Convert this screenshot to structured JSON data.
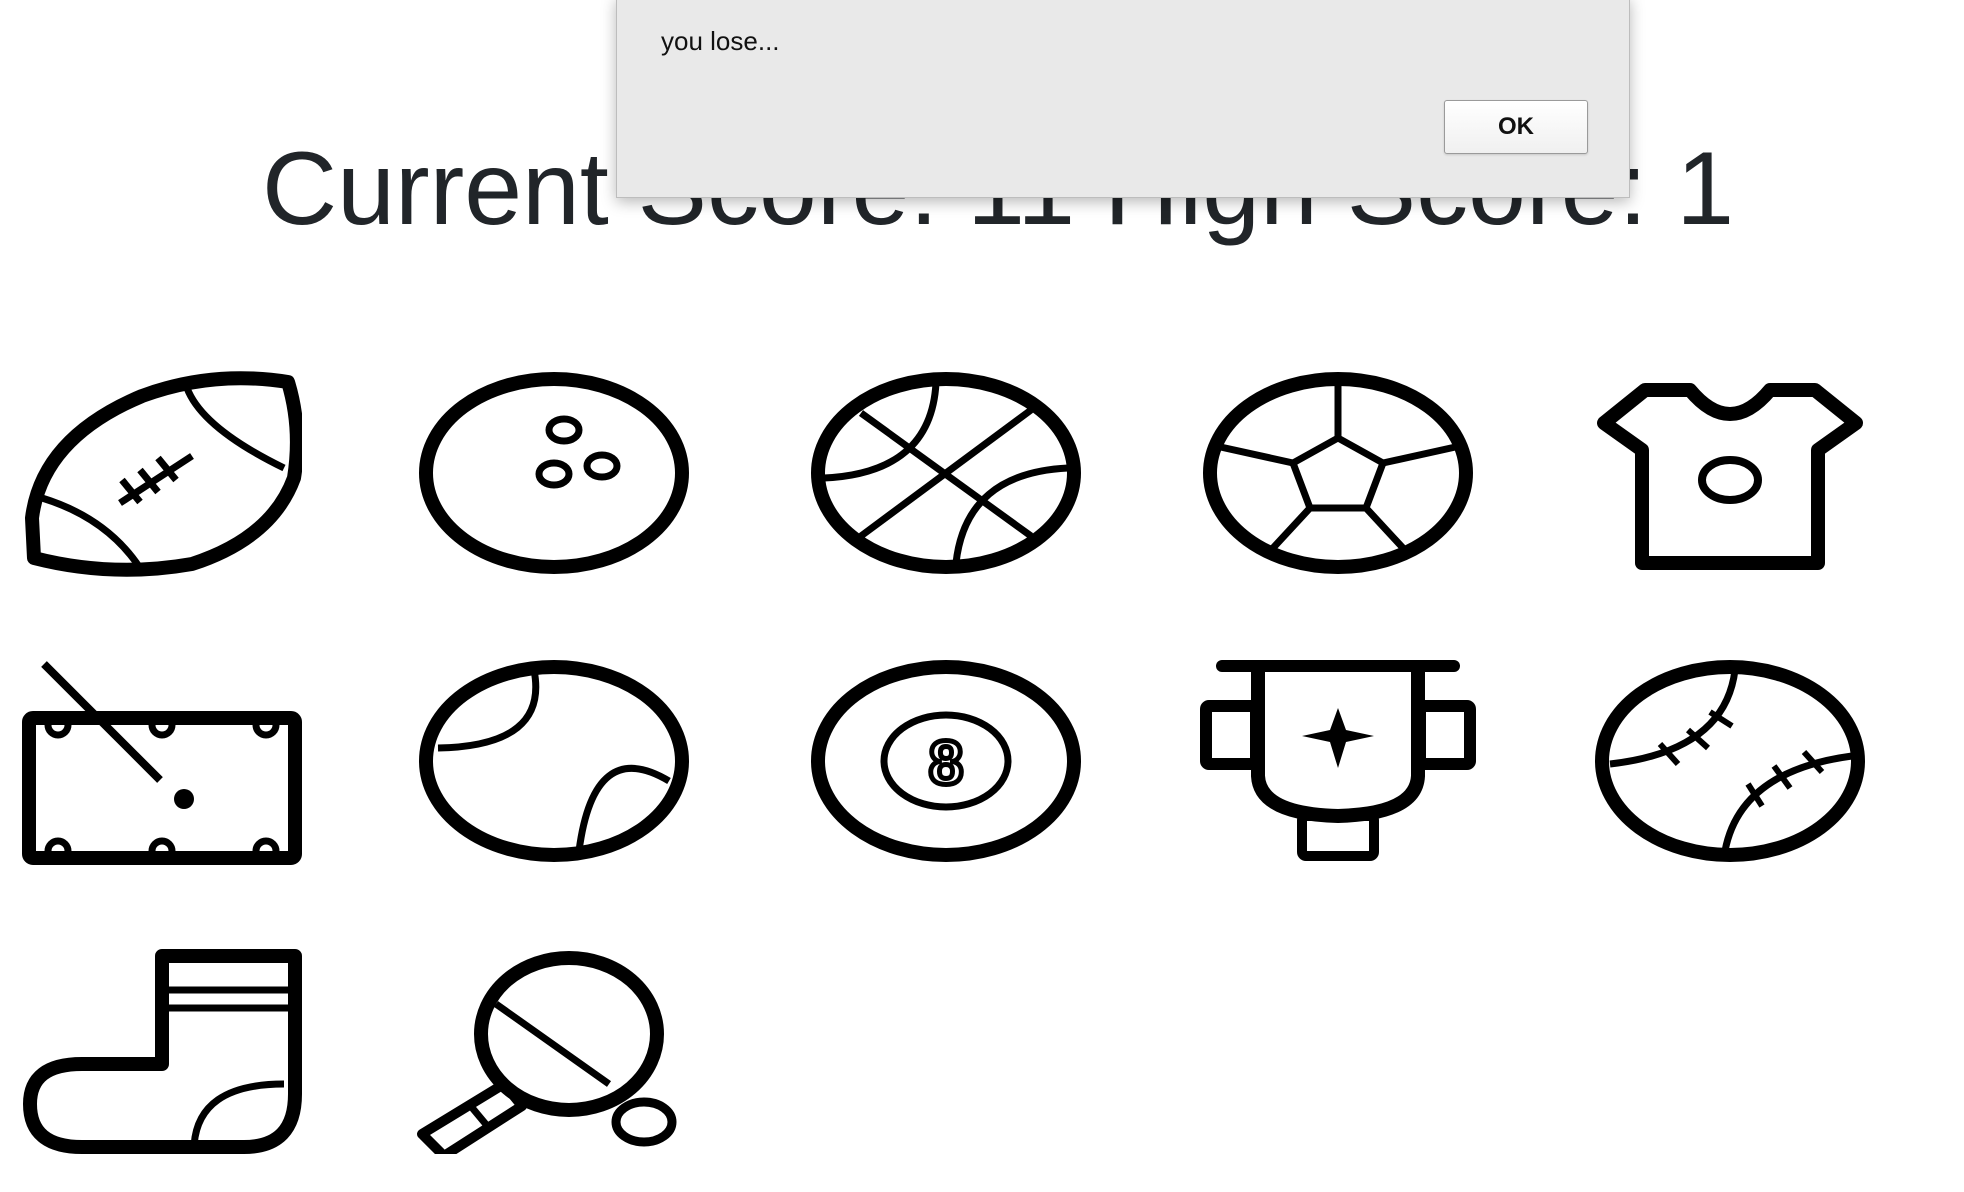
{
  "score": {
    "text": "Current Score: 11 High Score: 1"
  },
  "alert": {
    "message": "you lose...",
    "ok_label": "OK"
  },
  "cards": [
    {
      "icon": "american-football-icon"
    },
    {
      "icon": "bowling-ball-icon"
    },
    {
      "icon": "basketball-icon"
    },
    {
      "icon": "soccer-ball-icon"
    },
    {
      "icon": "jersey-icon"
    },
    {
      "icon": "pool-table-icon"
    },
    {
      "icon": "tennis-ball-icon"
    },
    {
      "icon": "eight-ball-icon"
    },
    {
      "icon": "trophy-icon"
    },
    {
      "icon": "baseball-icon"
    },
    {
      "icon": "sock-icon"
    },
    {
      "icon": "ping-pong-paddle-icon"
    }
  ]
}
